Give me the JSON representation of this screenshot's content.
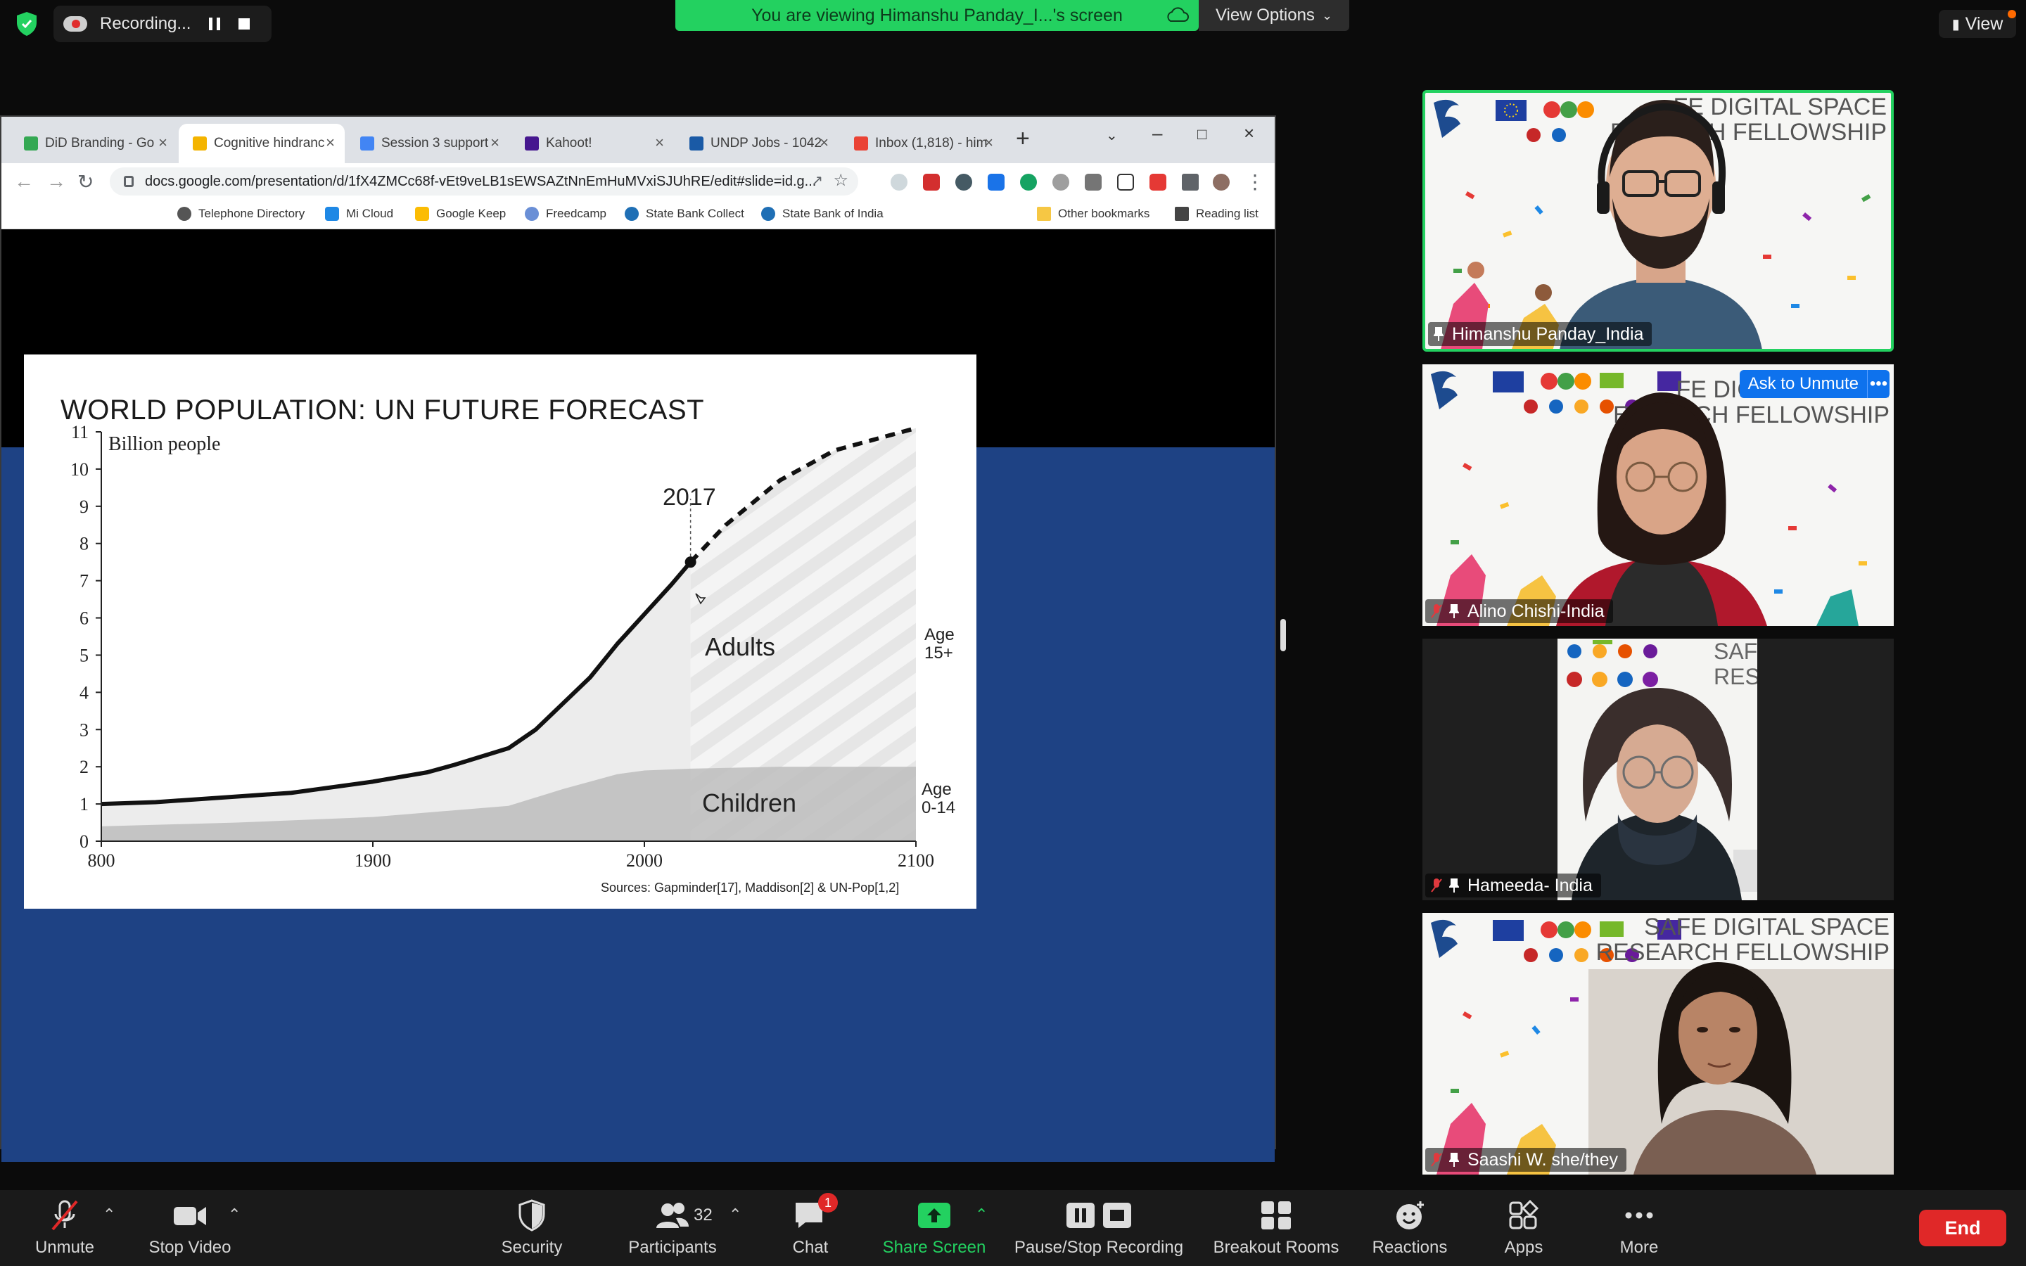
{
  "top": {
    "recording_label": "Recording...",
    "viewing_text": "You are viewing Himanshu Panday_I...'s screen",
    "view_options_label": "View Options",
    "view_label": "View"
  },
  "browser": {
    "tabs": [
      {
        "label": "DiD Branding - Go",
        "color": "#34a853"
      },
      {
        "label": "Cognitive hindranc",
        "color": "#f4b400"
      },
      {
        "label": "Session 3 support",
        "color": "#4285f4"
      },
      {
        "label": "Kahoot!",
        "color": "#46178f"
      },
      {
        "label": "UNDP Jobs - 1042",
        "color": "#1a5aa6"
      },
      {
        "label": "Inbox (1,818) - him",
        "color": "#ea4335"
      }
    ],
    "url": "docs.google.com/presentation/d/1fX4ZMCc68f-vEt9veLB1sEWSAZtNnEmHuMVxiSJUhRE/edit#slide=id.g...",
    "bookmarks": [
      {
        "label": "Telephone Directory",
        "color": "#555555"
      },
      {
        "label": "Mi Cloud",
        "color": "#1e88e5"
      },
      {
        "label": "Google Keep",
        "color": "#fbbc04"
      },
      {
        "label": "Freedcamp",
        "color": "#6a8fd6"
      },
      {
        "label": "State Bank Collect",
        "color": "#1f6fb5"
      },
      {
        "label": "State Bank of India",
        "color": "#1f6fb5"
      },
      {
        "label": "Other bookmarks",
        "color": "#f6c744"
      },
      {
        "label": "Reading list",
        "color": "#444444"
      }
    ]
  },
  "chart_data": {
    "type": "area",
    "title": "WORLD POPULATION: UN FUTURE FORECAST",
    "ylabel": "Billion people",
    "xlabel": "",
    "xlim": [
      1800,
      2100
    ],
    "ylim": [
      0,
      11
    ],
    "x_ticks": [
      "800",
      "1900",
      "2000",
      "2100"
    ],
    "y_ticks": [
      "0",
      "1",
      "2",
      "3",
      "4",
      "5",
      "6",
      "7",
      "8",
      "9",
      "10",
      "11"
    ],
    "total": {
      "x": [
        1800,
        1820,
        1850,
        1870,
        1900,
        1920,
        1930,
        1950,
        1960,
        1970,
        1980,
        1990,
        2000,
        2010,
        2017
      ],
      "y": [
        1.0,
        1.05,
        1.2,
        1.3,
        1.6,
        1.85,
        2.05,
        2.5,
        3.0,
        3.7,
        4.4,
        5.3,
        6.1,
        6.9,
        7.5
      ]
    },
    "forecast": {
      "x": [
        2017,
        2030,
        2040,
        2050,
        2060,
        2070,
        2080,
        2090,
        2100
      ],
      "y": [
        7.5,
        8.5,
        9.1,
        9.7,
        10.1,
        10.5,
        10.7,
        10.9,
        11.1
      ]
    },
    "children": {
      "x": [
        1800,
        1850,
        1900,
        1950,
        1970,
        1990,
        2000,
        2017,
        2050,
        2100
      ],
      "y": [
        0.4,
        0.5,
        0.65,
        0.95,
        1.4,
        1.8,
        1.9,
        1.95,
        2.0,
        2.0
      ]
    },
    "annotations": {
      "year_marker": "2017",
      "adults": "Adults",
      "children": "Children",
      "age_adult_1": "Age",
      "age_adult_2": "15+",
      "age_child_1": "Age",
      "age_child_2": "0-14",
      "sources": "Sources: Gapminder[17], Maddison[2] & UN-Pop[1,2]"
    },
    "grid": false,
    "legend": "none"
  },
  "participants": [
    {
      "name": "Himanshu Panday_India",
      "muted": false
    },
    {
      "name": "Alino Chishi-India",
      "muted": true
    },
    {
      "name": "Hameeda- India",
      "muted": true
    },
    {
      "name": "Saashi W. she/they",
      "muted": true
    }
  ],
  "tile_banner": {
    "line1": "SAFE DIGITAL SPACE",
    "line2": "RESEARCH FELLOWSHIP",
    "partial1": "FE DIGITAL SPACE",
    "partial2": "ESEARCH FELLOWSHIP",
    "short1": "SAFE",
    "short2": "RESEA"
  },
  "tile_actions": {
    "ask_unmute": "Ask to Unmute",
    "more": "•••"
  },
  "toolbar": {
    "unmute": "Unmute",
    "stop_video": "Stop Video",
    "security": "Security",
    "participants": "Participants",
    "participants_count": "32",
    "chat": "Chat",
    "chat_badge": "1",
    "share_screen": "Share Screen",
    "pause_stop": "Pause/Stop Recording",
    "breakout": "Breakout Rooms",
    "reactions": "Reactions",
    "apps": "Apps",
    "more": "More",
    "end": "End"
  },
  "colors": {
    "accent_green": "#23d160",
    "zoom_blue": "#0e72ed",
    "end_red": "#e02828",
    "slide_blue": "#1e4284"
  }
}
